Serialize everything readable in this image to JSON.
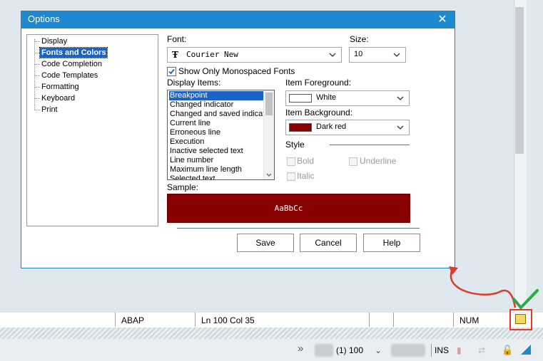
{
  "dialog": {
    "title": "Options",
    "close_glyph": "✕",
    "tree": [
      {
        "label": "Display"
      },
      {
        "label": "Fonts and Colors",
        "selected": true
      },
      {
        "label": "Code Completion"
      },
      {
        "label": "Code Templates"
      },
      {
        "label": "Formatting"
      },
      {
        "label": "Keyboard"
      },
      {
        "label": "Print"
      }
    ],
    "font": {
      "label": "Font:",
      "value": "Courier New"
    },
    "size": {
      "label": "Size:",
      "value": "10"
    },
    "mono_check": {
      "label": "Show Only Monospaced Fonts",
      "checked": true
    },
    "display_items": {
      "label": "Display Items:",
      "items": [
        "Breakpoint",
        "Changed indicator",
        "Changed and saved indicat",
        "Current line",
        "Erroneous line",
        "Execution",
        "Inactive selected text",
        "Line number",
        "Maximum line length",
        "Selected text"
      ],
      "selected": "Breakpoint"
    },
    "foreground": {
      "label": "Item Foreground:",
      "value": "White",
      "color": "#ffffff"
    },
    "background": {
      "label": "Item Background:",
      "value": "Dark red",
      "color": "#880000"
    },
    "style": {
      "label": "Style",
      "bold": "Bold",
      "underline": "Underline",
      "italic": "Italic"
    },
    "sample": {
      "label": "Sample:",
      "text": "AaBbCc"
    },
    "buttons": {
      "save": "Save",
      "cancel": "Cancel",
      "help": "Help"
    }
  },
  "statusbar": {
    "language": "ABAP",
    "position": "Ln 100 Col  35",
    "num": "NUM"
  },
  "sysbar": {
    "session": "(1) 100",
    "mode": "INS"
  },
  "colors": {
    "title_bar": "#1e88d0",
    "selection": "#1a63c9",
    "annotation_arrow": "#e0382b",
    "annotation_check": "#2aa84a"
  }
}
